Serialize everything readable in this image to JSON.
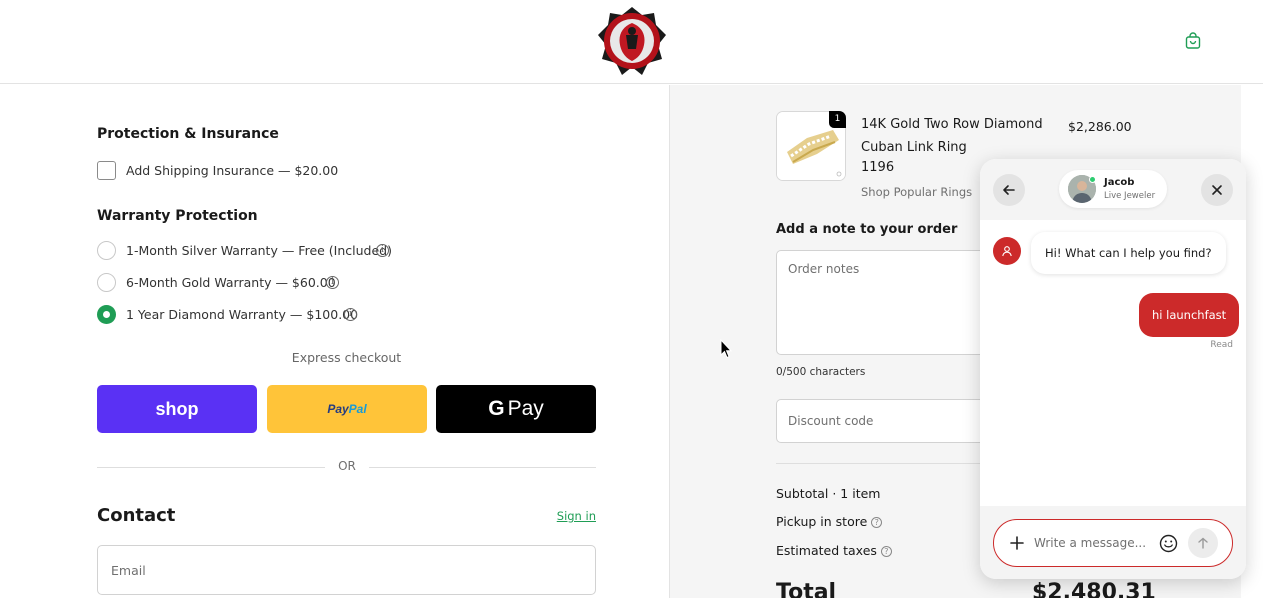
{
  "header": {
    "logo_icon": "red-shield-crest-logo-icon",
    "cart_icon": "shopping-bag-icon",
    "accent_color": "#1f9d55"
  },
  "protection": {
    "title": "Protection & Insurance",
    "insurance_label": "Add Shipping Insurance — $20.00",
    "insurance_checked": false
  },
  "warranty": {
    "title": "Warranty Protection",
    "options": [
      {
        "label": "1-Month Silver Warranty — Free (Included)",
        "selected": false
      },
      {
        "label": "6-Month Gold Warranty — $60.00",
        "selected": false
      },
      {
        "label": "1 Year Diamond Warranty — $100.00",
        "selected": true
      }
    ]
  },
  "express": {
    "title": "Express checkout",
    "shop_label": "shop",
    "paypal_label_1": "Pay",
    "paypal_label_2": "Pal",
    "gpay_g": "G",
    "gpay_label": "Pay",
    "shop_color": "#5a31f4",
    "paypal_color": "#ffc439",
    "gpay_color": "#000000"
  },
  "divider": {
    "or_label": "OR"
  },
  "contact": {
    "title": "Contact",
    "signin_label": "Sign in",
    "email_placeholder": "Email"
  },
  "product": {
    "name": "14K Gold Two Row Diamond Cuban Link Ring",
    "sku": "1196",
    "category": "Shop Popular Rings",
    "price": "$2,286.00"
  },
  "order_note": {
    "title": "Add a note to your order",
    "placeholder": "Order notes",
    "char_count": "0/500 characters"
  },
  "discount": {
    "placeholder": "Discount code"
  },
  "summary": {
    "subtotal_label": "Subtotal · 1 item",
    "pickup_label": "Pickup in store",
    "taxes_label": "Estimated taxes",
    "total_label": "Total",
    "total_value": "$2,480.31"
  },
  "chat": {
    "agent_name": "Jacob",
    "agent_role": "Live Jeweler",
    "incoming_message": "Hi! What can I help you find?",
    "outgoing_message": "hi launchfast",
    "read_status": "Read",
    "input_placeholder": "Write a message...",
    "brand_color": "#cc2a2a"
  }
}
